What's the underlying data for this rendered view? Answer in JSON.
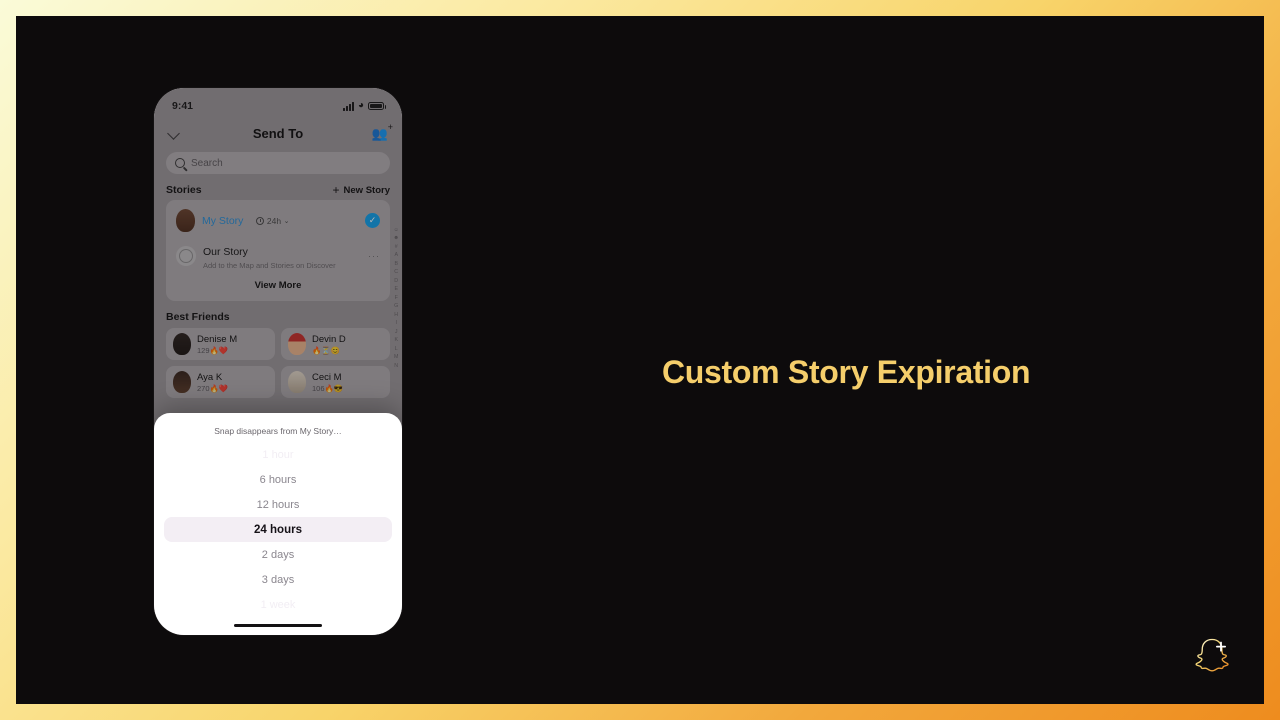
{
  "headline": "Custom Story Expiration",
  "theme": {
    "accent_gold": "#f5ce6b",
    "stage_bg": "#0d0b0c",
    "border_gradient": [
      "#fafbd8",
      "#fbe9a0",
      "#f8d46a",
      "#f2a83c",
      "#ee8c1e"
    ],
    "story_blue": "#2b8fd4",
    "check_blue": "#12a0e8",
    "selected_row_bg": "#f3eef4"
  },
  "phone": {
    "status_bar": {
      "time": "9:41",
      "icons": [
        "signal-icon",
        "wifi-icon",
        "battery-icon"
      ]
    },
    "nav": {
      "back_icon": "chevron-down-icon",
      "title": "Send To",
      "action_icon": "add-friends-icon"
    },
    "search": {
      "placeholder": "Search",
      "icon": "search-icon"
    },
    "stories_section": {
      "title": "Stories",
      "new_story_label": "New Story",
      "new_story_icon": "plus-icon",
      "items": [
        {
          "name": "My Story",
          "duration": "24h",
          "duration_icon": "clock-icon",
          "chevron": "⌄",
          "selected": true,
          "check_icon": "check-icon"
        },
        {
          "name": "Our Story",
          "subtitle": "Add to the Map and Stories on Discover",
          "more": "···"
        }
      ],
      "view_more_label": "View More"
    },
    "best_friends_section": {
      "title": "Best Friends",
      "friends": [
        {
          "name": "Denise M",
          "meta": "129🔥❤️"
        },
        {
          "name": "Devin D",
          "meta": "🔥⏳😊"
        },
        {
          "name": "Aya K",
          "meta": "270🔥❤️"
        },
        {
          "name": "Ceci M",
          "meta": "106🔥😎"
        }
      ]
    },
    "alphabet_index": [
      "☺",
      "☻",
      "#",
      "A",
      "B",
      "C",
      "D",
      "E",
      "F",
      "G",
      "H",
      "I",
      "J",
      "K",
      "L",
      "M",
      "N"
    ],
    "picker_sheet": {
      "title": "Snap disappears from My Story…",
      "options": [
        {
          "label": "1 hour",
          "state": "faint"
        },
        {
          "label": "6 hours",
          "state": "near"
        },
        {
          "label": "12 hours",
          "state": "near"
        },
        {
          "label": "24 hours",
          "state": "selected"
        },
        {
          "label": "2 days",
          "state": "near"
        },
        {
          "label": "3 days",
          "state": "near"
        },
        {
          "label": "1 week",
          "state": "faint"
        }
      ],
      "home_indicator": true
    }
  },
  "brand_logo": {
    "icon": "snapchat-ghost-add-icon"
  }
}
